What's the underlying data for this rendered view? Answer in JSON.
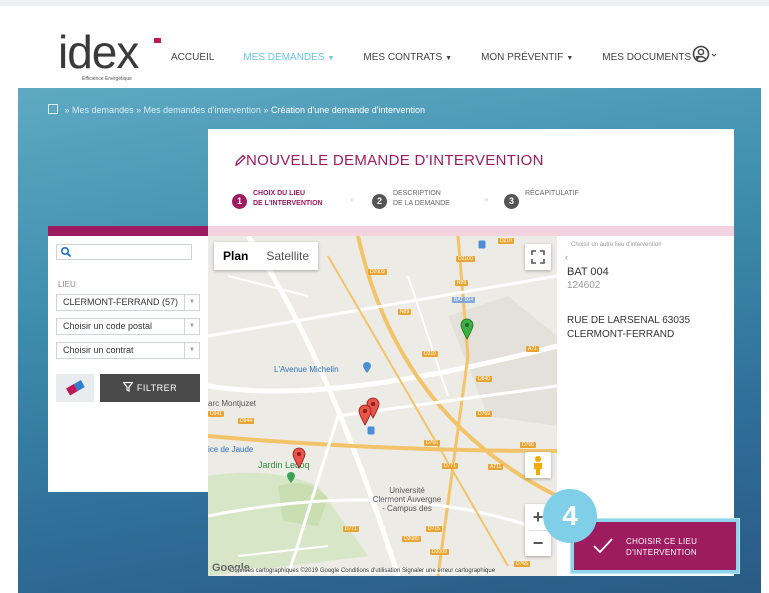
{
  "brand": {
    "logo_text": "idex",
    "tagline": "Efficience Energétique"
  },
  "nav": {
    "items": [
      {
        "label": "ACCUEIL",
        "caret": ""
      },
      {
        "label": "MES DEMANDES",
        "caret": "▼"
      },
      {
        "label": "MES CONTRATS",
        "caret": "▼"
      },
      {
        "label": "MON PRÉVENTIF",
        "caret": "▼"
      },
      {
        "label": "MES DOCUMENTS",
        "caret": "▼"
      }
    ],
    "active_index": 1
  },
  "breadcrumb": {
    "items": [
      "Mes demandes",
      "Mes demandes d'intervention"
    ],
    "current": "Création d'une demande d'intervention",
    "separator": "»"
  },
  "page": {
    "title": "NOUVELLE DEMANDE D'INTERVENTION"
  },
  "steps": [
    {
      "num": "1",
      "line1": "CHOIX DU LIEU",
      "line2": "DE L'INTERVENTION",
      "active": true
    },
    {
      "num": "2",
      "line1": "DESCRIPTION",
      "line2": "DE LA DEMANDE",
      "active": false
    },
    {
      "num": "3",
      "line1": "RÉCAPITULATIF",
      "line2": "",
      "active": false
    }
  ],
  "filter": {
    "search_placeholder": "",
    "lieu_label": "LIEU",
    "city_select": "CLERMONT-FERRAND (57)",
    "postal_select": "Choisir un code postal",
    "contract_select": "Choisir un contrat",
    "filter_button": "FILTRER"
  },
  "map": {
    "type_plan": "Plan",
    "type_satellite": "Satellite",
    "poi_labels": [
      "L'Avenue Michelin",
      "Jardin Lecoq",
      "Université Clermont Auvergne - Campus des",
      "arc Montjuzet",
      "ice de Jaude",
      "BAT 004"
    ],
    "road_labels": [
      "D210",
      "D2100",
      "N89",
      "A71",
      "D2009",
      "D210",
      "D840",
      "N89",
      "D769",
      "D766",
      "D766",
      "A711",
      "D941",
      "D944",
      "D771",
      "D715",
      "D2089",
      "D765",
      "D2009",
      "D771"
    ],
    "google": "Google",
    "footer": "Données cartographiques ©2019 Google   Conditions d'utilisation   Signaler une erreur cartographique"
  },
  "info": {
    "other_link": "Choisir un autre lieu d'intervention",
    "building": "BAT 004",
    "code": "124602",
    "street": "RUE DE LARSENAL 63035",
    "city": "CLERMONT-FERRAND"
  },
  "choose_button": {
    "line1": "CHOISIR CE LIEU",
    "line2": "D'INTERVENTION"
  },
  "tutorial_badge": "4",
  "colors": {
    "brand": "#9d1b5f",
    "nav_active": "#6cc4e3",
    "badge": "#7fcfe8"
  }
}
